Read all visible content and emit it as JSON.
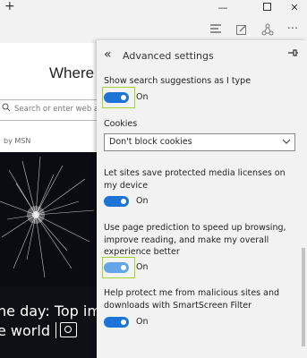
{
  "titlebar": {
    "new_tab": "+",
    "minimize": "—",
    "close": "✕"
  },
  "toolbar": {
    "icons": [
      "hub-icon",
      "note-icon",
      "share-icon",
      "more-icon"
    ],
    "more": "···"
  },
  "newtab": {
    "heading": "Where t",
    "search_placeholder": "Search or enter web add",
    "byline": "by MSN",
    "caption_line1": "he day: Top im",
    "caption_line2": "e world"
  },
  "settings": {
    "back": "«",
    "title": "Advanced settings",
    "pin": "⊣",
    "search_suggestions_label": "Show search suggestions as I type",
    "search_suggestions_state": "On",
    "cookies_label": "Cookies",
    "cookies_value": "Don't block cookies",
    "media_licenses_label": "Let sites save protected media licenses on my device",
    "media_licenses_state": "On",
    "page_prediction_label": "Use page prediction to speed up browsing, improve reading, and make my overall experience better",
    "page_prediction_state": "On",
    "smartscreen_label": "Help protect me from malicious sites and downloads with SmartScreen Filter",
    "smartscreen_state": "On"
  },
  "colors": {
    "toggle_on": "#1e73d6",
    "toggle_hover": "#63a6e8",
    "highlight": "#a5d233"
  }
}
